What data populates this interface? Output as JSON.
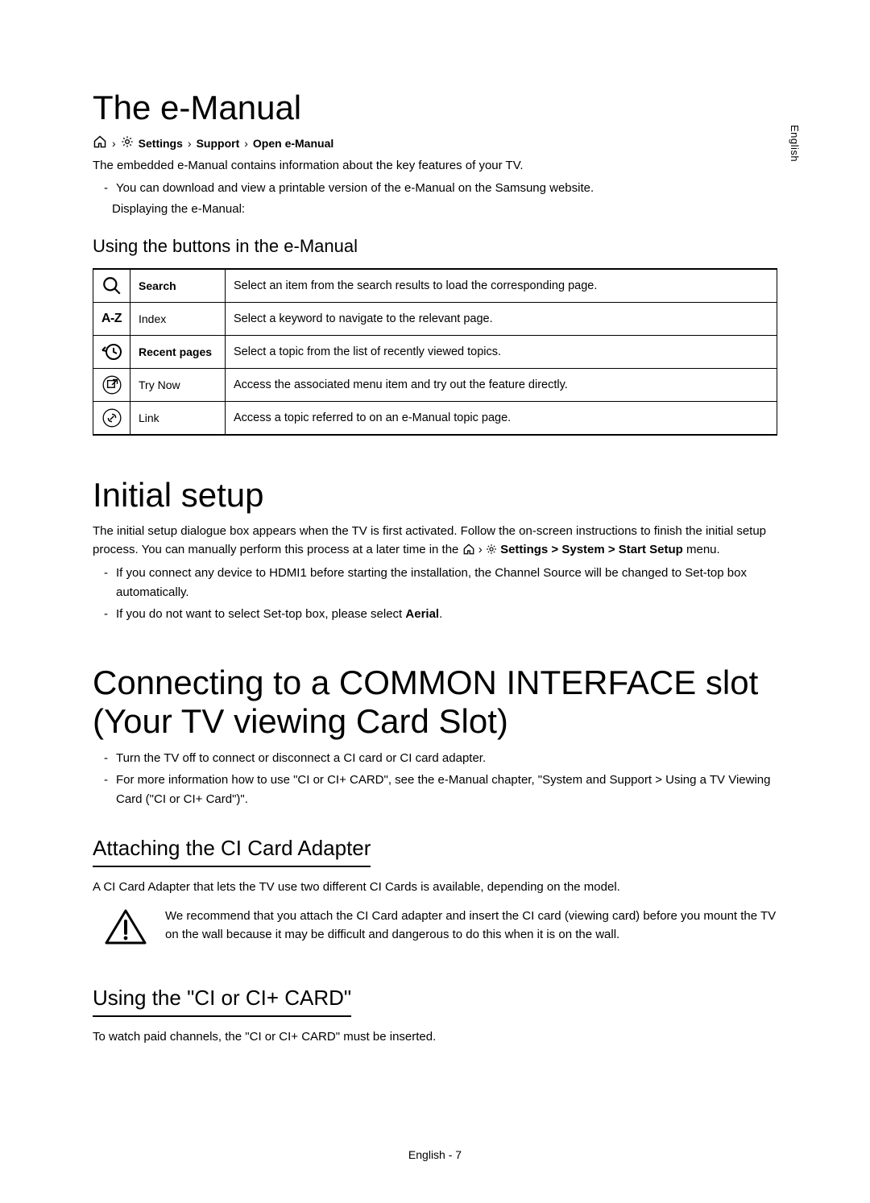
{
  "side_label": "English",
  "sections": {
    "emanual": {
      "title": "The e-Manual",
      "breadcrumb": {
        "settings": "Settings",
        "support": "Support",
        "open": "Open e-Manual"
      },
      "intro": "The embedded e-Manual contains information about the key features of your TV.",
      "bullet1": "You can download and view a printable version of the e-Manual on the Samsung website.",
      "bullet1b": "Displaying the e-Manual:",
      "subheading": "Using the buttons in the e-Manual",
      "table": [
        {
          "icon": "search",
          "name": "Search",
          "desc": "Select an item from the search results to load the corresponding page."
        },
        {
          "icon": "az",
          "name": "Index",
          "desc": "Select a keyword to navigate to the relevant page."
        },
        {
          "icon": "recent",
          "name": "Recent pages",
          "desc": "Select a topic from the list of recently viewed topics."
        },
        {
          "icon": "trynow",
          "name": "Try Now",
          "desc": "Access the associated menu item and try out the feature directly."
        },
        {
          "icon": "link",
          "name": "Link",
          "desc": "Access a topic referred to on an e-Manual topic page."
        }
      ]
    },
    "initial": {
      "title": "Initial setup",
      "intro_a": "The initial setup dialogue box appears when the TV is first activated. Follow the on-screen instructions to finish the initial setup process. You can manually perform this process at a later time in the ",
      "intro_b_path": "Settings > System > Start Setup",
      "intro_c": " menu.",
      "bullet1": "If you connect any device to HDMI1 before starting the installation, the Channel Source will be changed to Set-top box automatically.",
      "bullet2_a": "If you do not want to select Set-top box, please select ",
      "bullet2_b": "Aerial",
      "bullet2_c": "."
    },
    "ci": {
      "title": "Connecting to a COMMON INTERFACE slot (Your TV viewing Card Slot)",
      "bullet1": "Turn the TV off to connect or disconnect a CI card or CI card adapter.",
      "bullet2": "For more information how to use \"CI or CI+ CARD\", see the e-Manual chapter, \"System and Support > Using a TV Viewing Card (\"CI or CI+ Card\")\".",
      "sub1": "Attaching the CI Card Adapter",
      "sub1_body": "A CI Card Adapter that lets the TV use two different CI Cards is available, depending on the model.",
      "warn": "We recommend that you attach the CI Card adapter and insert the CI card (viewing card) before you mount the TV on the wall because it may be difficult and dangerous to do this when it is on the wall.",
      "sub2": "Using the \"CI or CI+ CARD\"",
      "sub2_body": "To watch paid channels, the \"CI or CI+ CARD\" must be inserted."
    }
  },
  "footer": "English - 7",
  "icons": {
    "az_label": "A-Z"
  }
}
